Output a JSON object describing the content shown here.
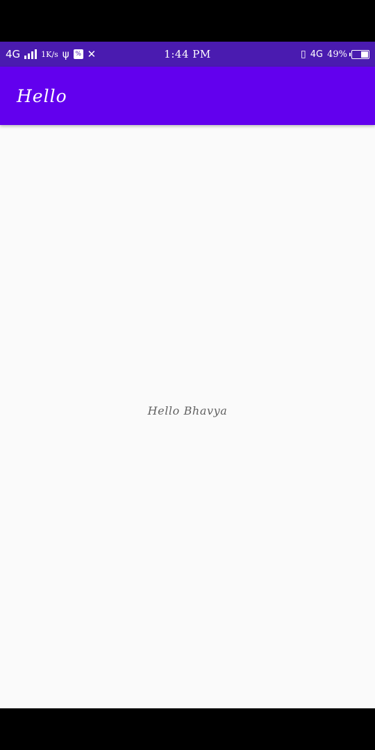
{
  "status_bar": {
    "network_label": "4G",
    "data_speed": "1K/s",
    "time": "1:44 PM",
    "network_type": "4G",
    "battery_percent": "49%",
    "battery_level": 0.49,
    "background_color": "#4a1bb0",
    "icons": [
      "signal-bars-icon",
      "usb-icon",
      "vpn-box-icon",
      "tools-icon",
      "vibrate-icon",
      "4g-arrows-icon",
      "battery-charging-icon"
    ]
  },
  "app_bar": {
    "title": "Hello",
    "background_color": "#6200ee"
  },
  "body": {
    "text": "Hello Bhavya",
    "background_color": "#fafafa"
  }
}
